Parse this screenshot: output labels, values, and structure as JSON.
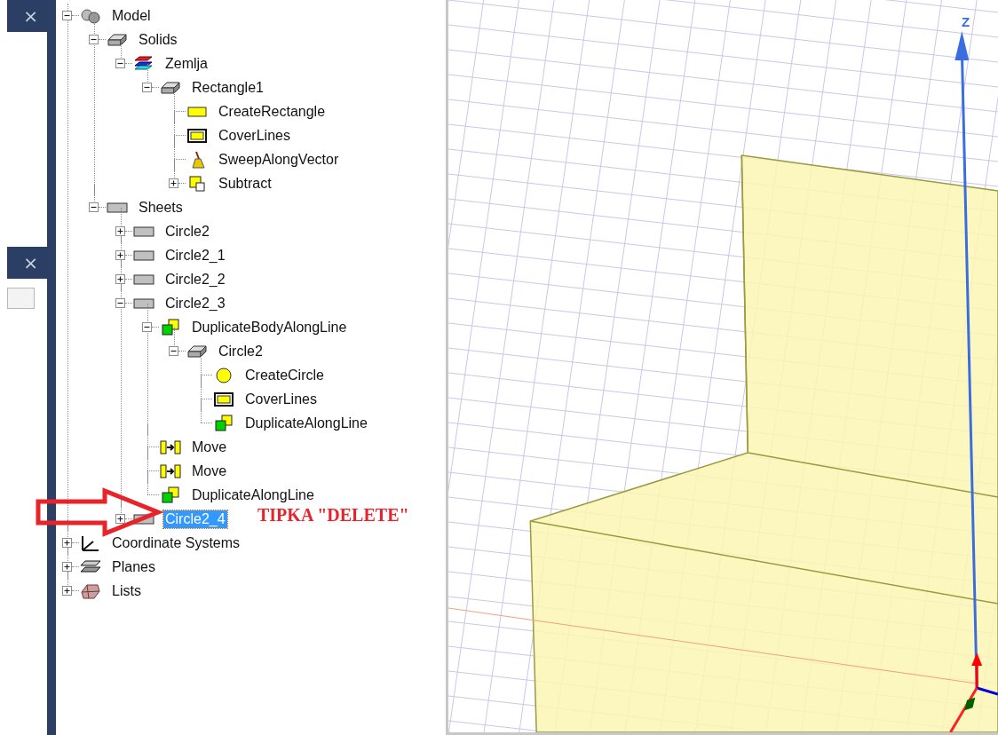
{
  "left_panels": [
    {
      "close": "×"
    },
    {
      "close": "×"
    }
  ],
  "tree": [
    {
      "label": "Model",
      "kind": "model",
      "expanded": true,
      "selected": false,
      "children": [
        {
          "label": "Solids",
          "kind": "solid",
          "expanded": true,
          "selected": false,
          "children": [
            {
              "label": "Zemlja",
              "kind": "material",
              "expanded": true,
              "selected": false,
              "children": [
                {
                  "label": "Rectangle1",
                  "kind": "solid",
                  "expanded": true,
                  "selected": false,
                  "children": [
                    {
                      "label": "CreateRectangle",
                      "kind": "rectangle",
                      "selected": false
                    },
                    {
                      "label": "CoverLines",
                      "kind": "cover",
                      "selected": false
                    },
                    {
                      "label": "SweepAlongVector",
                      "kind": "sweep",
                      "selected": false
                    },
                    {
                      "label": "Subtract",
                      "kind": "subtract",
                      "expanded": false,
                      "selected": false
                    }
                  ]
                }
              ]
            }
          ]
        },
        {
          "label": "Sheets",
          "kind": "sheet",
          "expanded": true,
          "selected": false,
          "children": [
            {
              "label": "Circle2",
              "kind": "sheet",
              "expanded": false,
              "selected": false
            },
            {
              "label": "Circle2_1",
              "kind": "sheet",
              "expanded": false,
              "selected": false
            },
            {
              "label": "Circle2_2",
              "kind": "sheet",
              "expanded": false,
              "selected": false
            },
            {
              "label": "Circle2_3",
              "kind": "sheet",
              "expanded": true,
              "selected": false,
              "children": [
                {
                  "label": "DuplicateBodyAlongLine",
                  "kind": "duplicate",
                  "expanded": true,
                  "selected": false,
                  "children": [
                    {
                      "label": "Circle2",
                      "kind": "solid",
                      "expanded": true,
                      "selected": false,
                      "children": [
                        {
                          "label": "CreateCircle",
                          "kind": "circle",
                          "selected": false
                        },
                        {
                          "label": "CoverLines",
                          "kind": "cover",
                          "selected": false
                        },
                        {
                          "label": "DuplicateAlongLine",
                          "kind": "duplicate",
                          "selected": false
                        }
                      ]
                    }
                  ]
                },
                {
                  "label": "Move",
                  "kind": "move",
                  "selected": false
                },
                {
                  "label": "Move",
                  "kind": "move",
                  "selected": false
                },
                {
                  "label": "DuplicateAlongLine",
                  "kind": "duplicate",
                  "selected": false
                }
              ]
            },
            {
              "label": "Circle2_4",
              "kind": "sheet",
              "expanded": false,
              "selected": true
            }
          ]
        }
      ]
    },
    {
      "label": "Coordinate Systems",
      "kind": "axes",
      "expanded": false,
      "selected": false
    },
    {
      "label": "Planes",
      "kind": "planes",
      "expanded": false,
      "selected": false
    },
    {
      "label": "Lists",
      "kind": "lists",
      "expanded": false,
      "selected": false
    }
  ],
  "viewport": {
    "axis_label": "Z"
  },
  "annotation": {
    "text": "TIPKA \"DELETE\""
  }
}
